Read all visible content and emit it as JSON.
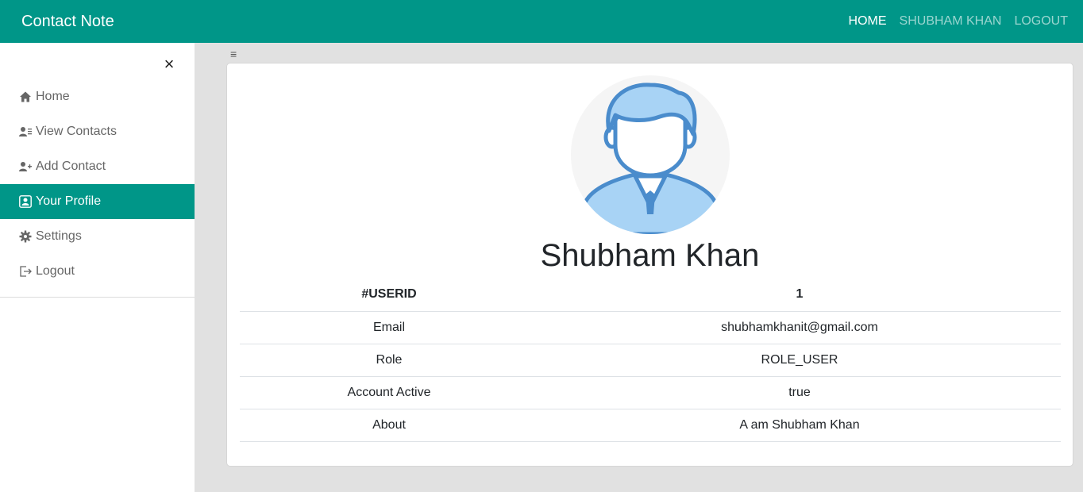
{
  "navbar": {
    "brand": "Contact Note",
    "links": [
      {
        "label": "HOME"
      },
      {
        "label": "SHUBHAM KHAN"
      },
      {
        "label": "LOGOUT"
      }
    ]
  },
  "sidebar": {
    "close_icon": "×",
    "items": [
      {
        "label": "Home",
        "icon": "home-icon"
      },
      {
        "label": "View Contacts",
        "icon": "contacts-list-icon"
      },
      {
        "label": "Add Contact",
        "icon": "user-plus-icon"
      },
      {
        "label": "Your Profile",
        "icon": "profile-icon",
        "active": true
      },
      {
        "label": "Settings",
        "icon": "gear-icon"
      },
      {
        "label": "Logout",
        "icon": "logout-icon"
      }
    ]
  },
  "toggle_icon": "≡",
  "profile": {
    "name": "Shubham Khan",
    "header": {
      "key": "#USERID",
      "value": "1"
    },
    "rows": [
      {
        "key": "Email",
        "value": "shubhamkhanit@gmail.com"
      },
      {
        "key": "Role",
        "value": "ROLE_USER"
      },
      {
        "key": "Account Active",
        "value": "true"
      },
      {
        "key": "About",
        "value": "A am Shubham Khan"
      }
    ]
  },
  "colors": {
    "accent": "#009688",
    "background": "#e1e1e1"
  }
}
